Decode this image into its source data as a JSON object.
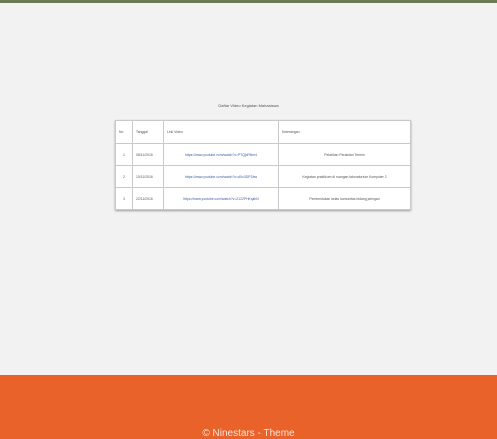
{
  "page": {
    "heading": "Daftar Video Kegiatan Mahasiswa"
  },
  "table": {
    "headers": [
      "No",
      "Tanggal",
      "Link Video",
      "Keterangan"
    ],
    "rows": [
      {
        "no": "1",
        "tanggal": "08/11/2016",
        "link": "https://www.youtube.com/watch?v=PTQjxRNm4",
        "keterangan": "Pelatihan Perakitan Termin"
      },
      {
        "no": "2",
        "tanggal": "10/11/2016",
        "link": "https://www.youtube.com/watch?v=dXv3DPSbw",
        "keterangan": "Kegiatan praktikum di ruangan laboratorium Komputer 2"
      },
      {
        "no": "3",
        "tanggal": "22/11/2016",
        "link": "https://www.youtube.com/watch?v=2122PHKqkhN",
        "keterangan": "Pembentukan kelas komunitas bidang jaringan"
      }
    ]
  },
  "footer": {
    "copyright": "© Ninestars - Theme"
  },
  "colors": {
    "footer_bg": "#e8622a",
    "topbar": "#6b7a52",
    "link": "#3b5fa8"
  }
}
